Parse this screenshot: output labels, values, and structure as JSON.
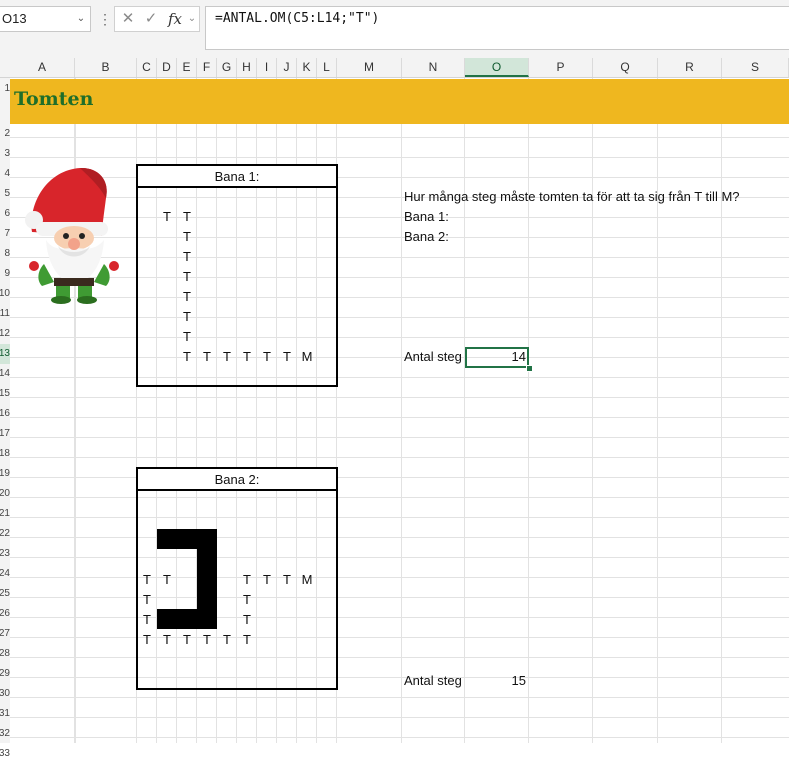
{
  "formula_bar": {
    "name_box": "O13",
    "cancel_icon": "✕",
    "enter_icon": "✓",
    "fx_label": "fx",
    "formula": "=ANTAL.OM(C5:L14;\"T\")"
  },
  "columns": [
    "A",
    "B",
    "C",
    "D",
    "E",
    "F",
    "G",
    "H",
    "I",
    "J",
    "K",
    "L",
    "M",
    "N",
    "O",
    "P",
    "Q",
    "R",
    "S"
  ],
  "selected_column": "O",
  "rows": [
    "1",
    "2",
    "3",
    "4",
    "5",
    "6",
    "7",
    "8",
    "9",
    "10",
    "11",
    "12",
    "13",
    "14",
    "15",
    "16",
    "17",
    "18",
    "19",
    "20",
    "21",
    "22",
    "23",
    "24",
    "25",
    "26",
    "27",
    "28",
    "29",
    "30",
    "31",
    "32",
    "33"
  ],
  "selected_row": "13",
  "sheet": {
    "title": "Tomten",
    "title_color": "#1f6e2a",
    "banner_color": "#efb71f",
    "question": "Hur många steg måste tomten ta för att ta sig från T till M?",
    "bana1_label": "Bana 1:",
    "bana2_label": "Bana 2:",
    "antal_steg_label_1": "Antal steg",
    "antal_steg_value_1": "14",
    "antal_steg_label_2": "Antal steg",
    "antal_steg_value_2": "15"
  },
  "board1": {
    "header": "Bana 1:",
    "cells": [
      {
        "col": 1,
        "row": 1,
        "v": "T"
      },
      {
        "col": 2,
        "row": 1,
        "v": "T"
      },
      {
        "col": 2,
        "row": 2,
        "v": "T"
      },
      {
        "col": 2,
        "row": 3,
        "v": "T"
      },
      {
        "col": 2,
        "row": 4,
        "v": "T"
      },
      {
        "col": 2,
        "row": 5,
        "v": "T"
      },
      {
        "col": 2,
        "row": 6,
        "v": "T"
      },
      {
        "col": 2,
        "row": 7,
        "v": "T"
      },
      {
        "col": 2,
        "row": 8,
        "v": "T"
      },
      {
        "col": 3,
        "row": 8,
        "v": "T"
      },
      {
        "col": 4,
        "row": 8,
        "v": "T"
      },
      {
        "col": 5,
        "row": 8,
        "v": "T"
      },
      {
        "col": 6,
        "row": 8,
        "v": "T"
      },
      {
        "col": 7,
        "row": 8,
        "v": "T"
      },
      {
        "col": 8,
        "row": 8,
        "v": "M"
      }
    ]
  },
  "board2": {
    "header": "Bana 2:",
    "cells": [
      {
        "col": 0,
        "row": 4,
        "v": "T"
      },
      {
        "col": 1,
        "row": 4,
        "v": "T"
      },
      {
        "col": 5,
        "row": 4,
        "v": "T"
      },
      {
        "col": 6,
        "row": 4,
        "v": "T"
      },
      {
        "col": 7,
        "row": 4,
        "v": "T"
      },
      {
        "col": 8,
        "row": 4,
        "v": "M"
      },
      {
        "col": 0,
        "row": 5,
        "v": "T"
      },
      {
        "col": 5,
        "row": 5,
        "v": "T"
      },
      {
        "col": 0,
        "row": 6,
        "v": "T"
      },
      {
        "col": 5,
        "row": 6,
        "v": "T"
      },
      {
        "col": 0,
        "row": 7,
        "v": "T"
      },
      {
        "col": 1,
        "row": 7,
        "v": "T"
      },
      {
        "col": 2,
        "row": 7,
        "v": "T"
      },
      {
        "col": 3,
        "row": 7,
        "v": "T"
      },
      {
        "col": 4,
        "row": 7,
        "v": "T"
      },
      {
        "col": 5,
        "row": 7,
        "v": "T"
      }
    ]
  }
}
